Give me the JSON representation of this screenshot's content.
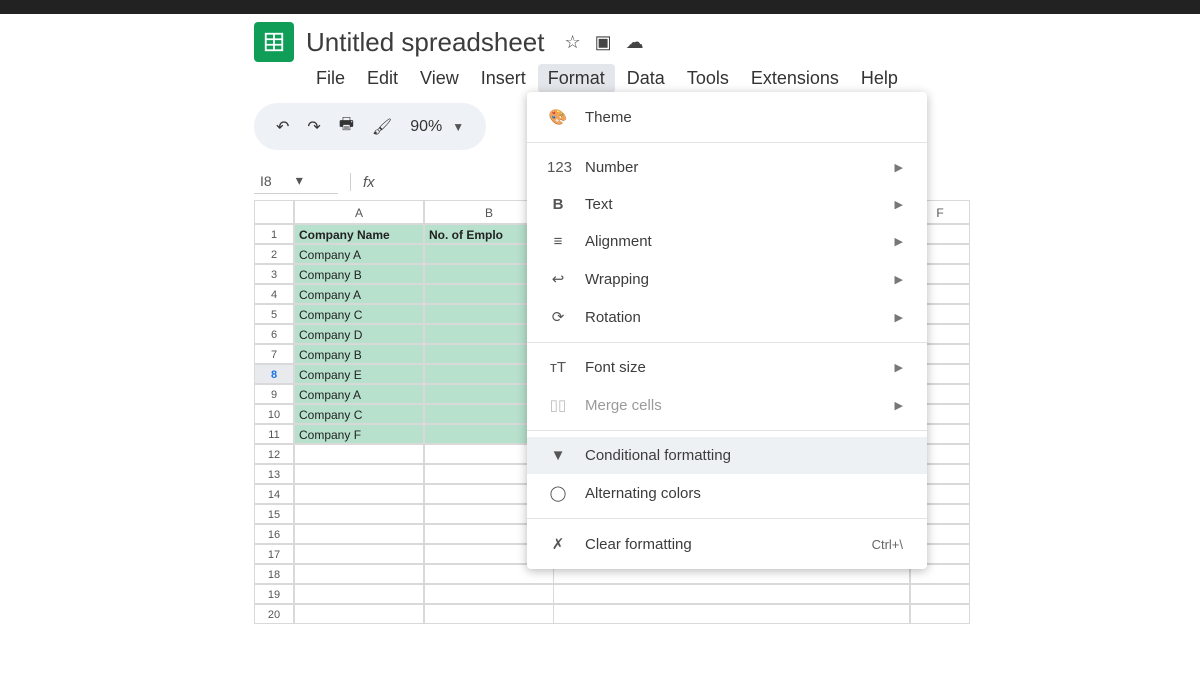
{
  "colors": {
    "accent_green": "#0f9d58",
    "cell_highlight": "#b7e1cd"
  },
  "doc": {
    "title": "Untitled spreadsheet"
  },
  "menubar": {
    "items": [
      "File",
      "Edit",
      "View",
      "Insert",
      "Format",
      "Data",
      "Tools",
      "Extensions",
      "Help"
    ],
    "active": "Format"
  },
  "toolbar": {
    "zoom": "90%"
  },
  "namebox": {
    "ref": "I8",
    "fx": ""
  },
  "columns": [
    "A",
    "B",
    "",
    "",
    "",
    "F"
  ],
  "rows": {
    "numbers": [
      1,
      2,
      3,
      4,
      5,
      6,
      7,
      8,
      9,
      10,
      11,
      12,
      13,
      14,
      15,
      16,
      17,
      18,
      19,
      20
    ],
    "selected": 8,
    "header": {
      "A": "Company Name",
      "B": "No. of Emplo"
    },
    "dataA": [
      "Company A",
      "Company B",
      "Company A",
      "Company C",
      "Company D",
      "Company B",
      "Company E",
      "Company A",
      "Company C",
      "Company F"
    ]
  },
  "format_menu": {
    "theme": "Theme",
    "number": "Number",
    "text": "Text",
    "alignment": "Alignment",
    "wrapping": "Wrapping",
    "rotation": "Rotation",
    "font_size": "Font size",
    "merge_cells": "Merge cells",
    "conditional": "Conditional formatting",
    "alternating": "Alternating colors",
    "clear": "Clear formatting",
    "clear_shortcut": "Ctrl+\\"
  }
}
